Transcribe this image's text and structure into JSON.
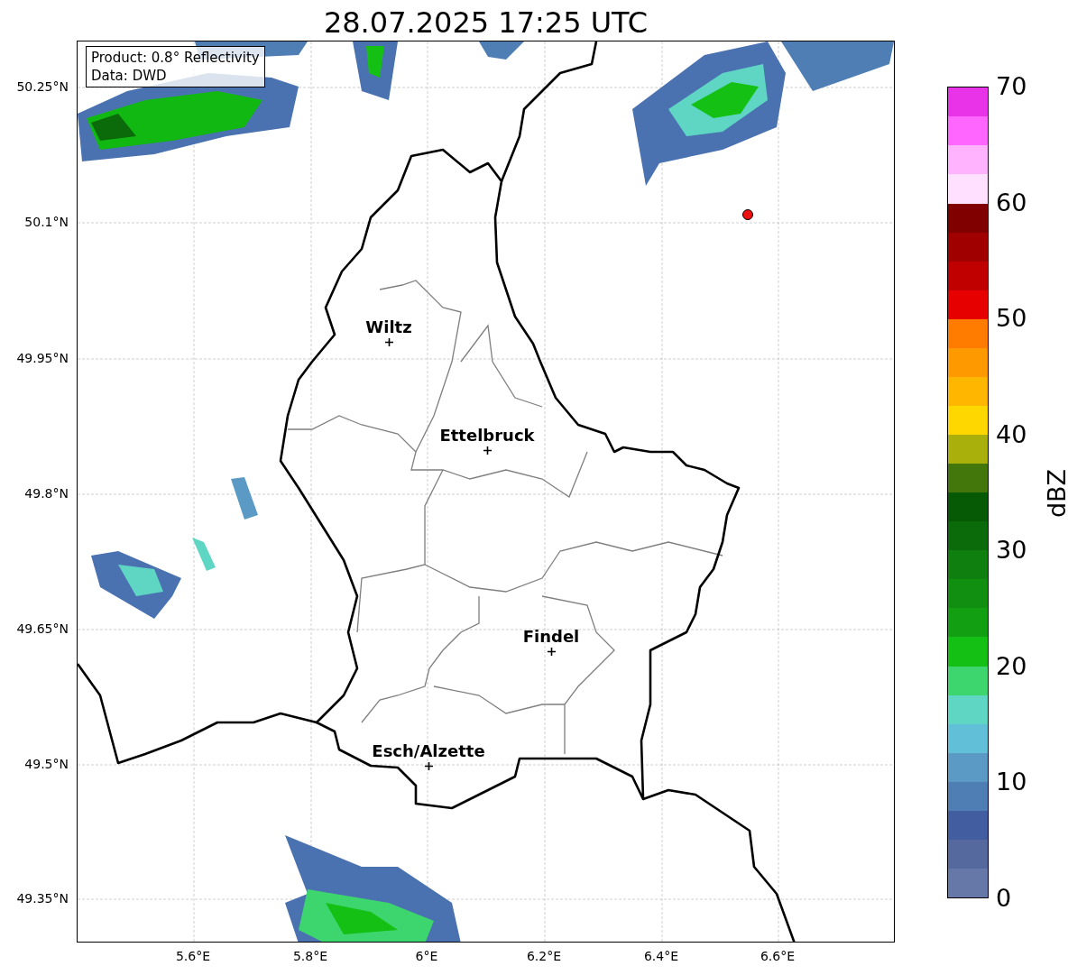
{
  "title": "28.07.2025 17:25 UTC",
  "info_box": [
    "Product: 0.8° Reflectivity",
    "Data: DWD"
  ],
  "map": {
    "cities": [
      {
        "name": "Wiltz"
      },
      {
        "name": "Ettelbruck"
      },
      {
        "name": "Findel"
      },
      {
        "name": "Esch/Alzette"
      }
    ],
    "y_ticks": [
      "50.25°N",
      "50.1°N",
      "49.95°N",
      "49.8°N",
      "49.65°N",
      "49.5°N",
      "49.35°N"
    ],
    "x_ticks": [
      "5.6°E",
      "5.8°E",
      "6°E",
      "6.2°E",
      "6.4°E",
      "6.6°E"
    ]
  },
  "colorbar": {
    "label": "dBZ",
    "ticks": [
      "70",
      "60",
      "50",
      "40",
      "30",
      "20",
      "10",
      "0"
    ],
    "segments": [
      {
        "color": "#6678a8"
      },
      {
        "color": "#56699f"
      },
      {
        "color": "#425ea0"
      },
      {
        "color": "#4f7eb5"
      },
      {
        "color": "#5a9ac4"
      },
      {
        "color": "#62bfd8"
      },
      {
        "color": "#5fd6c4"
      },
      {
        "color": "#3dd56d"
      },
      {
        "color": "#14c014"
      },
      {
        "color": "#12a012"
      },
      {
        "color": "#108f10"
      },
      {
        "color": "#0f7f0f"
      },
      {
        "color": "#0b6b0b"
      },
      {
        "color": "#065a06"
      },
      {
        "color": "#43760b"
      },
      {
        "color": "#aab00b"
      },
      {
        "color": "#ffd700"
      },
      {
        "color": "#ffb600"
      },
      {
        "color": "#ff9900"
      },
      {
        "color": "#ff7c00"
      },
      {
        "color": "#e60000"
      },
      {
        "color": "#c00000"
      },
      {
        "color": "#a00000"
      },
      {
        "color": "#800000"
      },
      {
        "color": "#ffe0ff"
      },
      {
        "color": "#ffb3ff"
      },
      {
        "color": "#ff66ff"
      },
      {
        "color": "#e833e8"
      }
    ]
  }
}
